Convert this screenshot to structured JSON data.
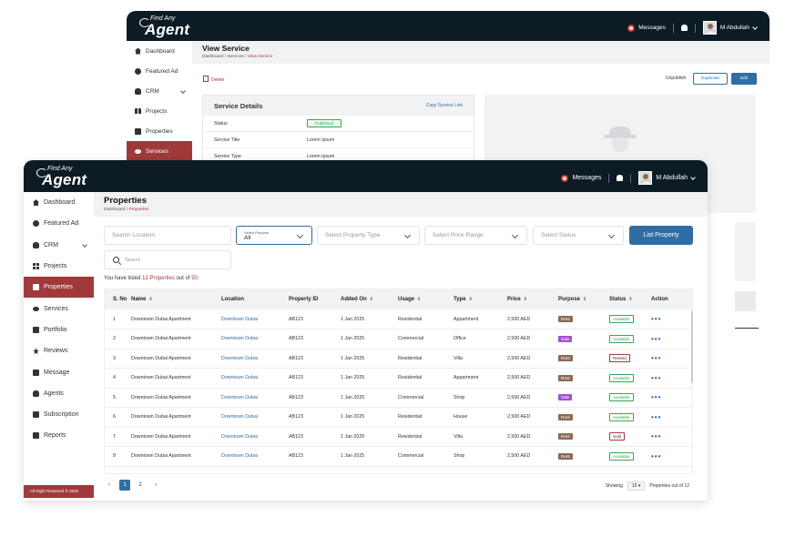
{
  "back": {
    "logo": {
      "small": "Find Any",
      "big": "Agent"
    },
    "topbar": {
      "messages": "Messages",
      "user": "M Abdullah"
    },
    "sidebar": [
      {
        "label": "Dashboard",
        "icon": "home-icon"
      },
      {
        "label": "Featured Ad",
        "icon": "sun-icon"
      },
      {
        "label": "CRM",
        "icon": "people-icon"
      },
      {
        "label": "Projects",
        "icon": "grid-icon"
      },
      {
        "label": "Properties",
        "icon": "building-icon"
      },
      {
        "label": "Services",
        "icon": "eye-icon"
      }
    ],
    "header": {
      "title": "View Service",
      "crumb_prefix": "Dashboard / Services / ",
      "crumb_current": "View Service"
    },
    "actions": {
      "delete": "Delete",
      "unpublish": "Unpublish",
      "duplicate": "Duplicate",
      "edit": "Edit"
    },
    "card": {
      "title": "Service Details",
      "link": "Copy Service Link",
      "rows": [
        {
          "key": "Status",
          "value": "Published"
        },
        {
          "key": "Service Title",
          "value": "Lorem Ipsum"
        },
        {
          "key": "Service Type",
          "value": "Lorem Ipsum"
        }
      ]
    }
  },
  "front": {
    "logo": {
      "small": "Find Any",
      "big": "Agent"
    },
    "topbar": {
      "messages": "Messages",
      "user": "M Abdullah"
    },
    "sidebar": [
      {
        "label": "Dashboard",
        "icon": "home-icon"
      },
      {
        "label": "Featured Ad",
        "icon": "sun-icon"
      },
      {
        "label": "CRM",
        "icon": "people-icon"
      },
      {
        "label": "Projects",
        "icon": "grid-icon"
      },
      {
        "label": "Properties",
        "icon": "building-icon"
      },
      {
        "label": "Services",
        "icon": "eye-icon"
      },
      {
        "label": "Portfolio",
        "icon": "portfolio-icon"
      },
      {
        "label": "Reviews",
        "icon": "star-icon"
      },
      {
        "label": "Message",
        "icon": "message-icon"
      },
      {
        "label": "Agents",
        "icon": "agents-icon"
      },
      {
        "label": "Subscription",
        "icon": "subscription-icon"
      },
      {
        "label": "Reports",
        "icon": "reports-icon"
      }
    ],
    "footer": "All Right Reserved ® 2025",
    "header": {
      "title": "Properties",
      "crumb_prefix": "Dashboard / ",
      "crumb_current": "Properties"
    },
    "filters": {
      "location_placeholder": "Search Location",
      "purpose_label": "Select Purpose",
      "purpose_value": "All",
      "property_type": "Select Property Type",
      "price_range": "Select Price Range",
      "status": "Select Status",
      "list_button": "List Property",
      "search_placeholder": "Search"
    },
    "listed": {
      "prefix": "You have listed ",
      "highlight": "12 Properties",
      "mid": " out of ",
      "total": "50",
      "suffix": "."
    },
    "table": {
      "headers": [
        "S. No",
        "Name",
        "Location",
        "Property ID",
        "Added On",
        "Usage",
        "Type",
        "Price",
        "Purpose",
        "Status",
        "Action"
      ],
      "rows": [
        {
          "no": "1",
          "name": "Downtown Dubai Apartment",
          "location": "Downtown Dubai",
          "id": "AB123",
          "added": "1 Jan 2025",
          "usage": "Residential",
          "type": "Appartment",
          "price": "2,500 AED",
          "purpose": "Rent",
          "status": "Available"
        },
        {
          "no": "2",
          "name": "Downtown Dubai Apartment",
          "location": "Downtown Dubai",
          "id": "AB123",
          "added": "1 Jan 2025",
          "usage": "Commercial",
          "type": "Office",
          "price": "2,500 AED",
          "purpose": "Sale",
          "status": "Available"
        },
        {
          "no": "3",
          "name": "Downtown Dubai Apartment",
          "location": "Downtown Dubai",
          "id": "AB123",
          "added": "1 Jan 2025",
          "usage": "Residential",
          "type": "Villa",
          "price": "2,500 AED",
          "purpose": "Rent",
          "status": "Rented"
        },
        {
          "no": "4",
          "name": "Downtown Dubai Apartment",
          "location": "Downtown Dubai",
          "id": "AB123",
          "added": "1 Jan 2025",
          "usage": "Residential",
          "type": "Appartment",
          "price": "2,500 AED",
          "purpose": "Rent",
          "status": "Available"
        },
        {
          "no": "5",
          "name": "Downtown Dubai Apartment",
          "location": "Downtown Dubai",
          "id": "AB123",
          "added": "1 Jan 2025",
          "usage": "Commercial",
          "type": "Shop",
          "price": "2,500 AED",
          "purpose": "Sale",
          "status": "Available"
        },
        {
          "no": "6",
          "name": "Downtown Dubai Apartment",
          "location": "Downtown Dubai",
          "id": "AB123",
          "added": "1 Jan 2025",
          "usage": "Residential",
          "type": "House",
          "price": "2,500 AED",
          "purpose": "Rent",
          "status": "Available"
        },
        {
          "no": "7",
          "name": "Downtown Dubai Apartment",
          "location": "Downtown Dubai",
          "id": "AB123",
          "added": "1 Jan 2025",
          "usage": "Residential",
          "type": "Villa",
          "price": "2,500 AED",
          "purpose": "Rent",
          "status": "Sold"
        },
        {
          "no": "8",
          "name": "Downtown Dubai Apartment",
          "location": "Downtown Dubai",
          "id": "AB123",
          "added": "1 Jan 2025",
          "usage": "Commercial",
          "type": "Shop",
          "price": "2,500 AED",
          "purpose": "Rent",
          "status": "Available"
        }
      ]
    },
    "pager": {
      "prev": "‹",
      "pages": [
        "1",
        "2"
      ],
      "next": "›"
    },
    "showing": {
      "label": "Showing",
      "per_page": "10 ▾",
      "suffix": "Properties out of 12"
    }
  },
  "colors": {
    "topbar": "#0d1b24",
    "accent": "#a0393a",
    "primary": "#2f6ea5",
    "rent": "#8a6a57",
    "sale": "#a64fd1",
    "available": "#3aa655",
    "rented": "#a0393a",
    "sold": "#a0393a"
  }
}
